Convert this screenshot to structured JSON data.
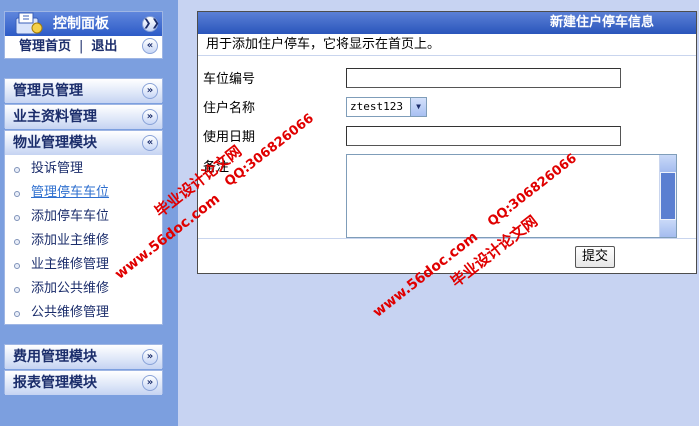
{
  "sidebar": {
    "control_panel_title": "控制面板",
    "home_link": "管理首页",
    "separator": "|",
    "logout_link": "退出",
    "sections": [
      {
        "label": "管理员管理"
      },
      {
        "label": "业主资料管理"
      },
      {
        "label": "物业管理模块"
      },
      {
        "label": "费用管理模块"
      },
      {
        "label": "报表管理模块"
      }
    ],
    "property_items": [
      {
        "label": "投诉管理"
      },
      {
        "label": "管理停车车位"
      },
      {
        "label": "添加停车车位"
      },
      {
        "label": "添加业主维修"
      },
      {
        "label": "业主维修管理"
      },
      {
        "label": "添加公共维修"
      },
      {
        "label": "公共维修管理"
      }
    ],
    "active_item": "管理停车车位"
  },
  "form": {
    "title": "新建住户停车信息",
    "description": "用于添加住户停车，它将显示在首页上。",
    "fields": {
      "space_number": {
        "label": "车位编号",
        "value": ""
      },
      "resident_name": {
        "label": "住户名称",
        "value": "ztest123"
      },
      "usage_date": {
        "label": "使用日期",
        "value": ""
      },
      "remarks": {
        "label": "备注",
        "value": ""
      }
    },
    "submit_label": "提交"
  },
  "watermarks": {
    "site": "www.56doc.com",
    "qq": "QQ:306826066",
    "brand": "毕业设计论文网"
  },
  "colors": {
    "sidebar_bg": "#7c9fdf",
    "page_bg": "#c7d3f2",
    "header_blue": "#2a55bb",
    "watermark_red": "#e00000"
  }
}
